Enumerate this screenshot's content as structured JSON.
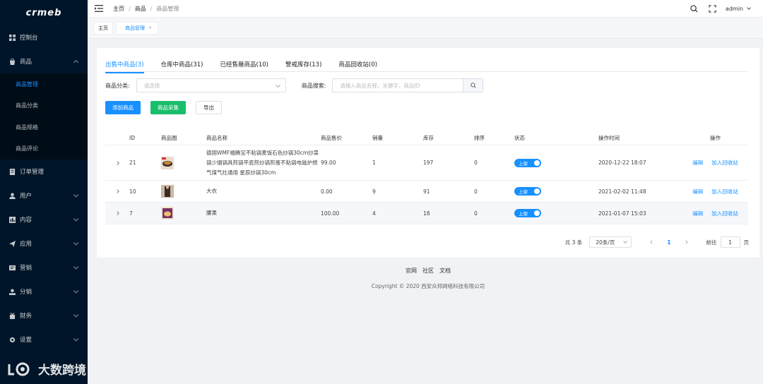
{
  "sidebar": {
    "logo": "crmeb",
    "items": [
      {
        "label": "控制台",
        "icon": "dashboard-icon"
      },
      {
        "label": "商品",
        "icon": "bag-icon",
        "expanded": true,
        "children": [
          {
            "label": "商品管理",
            "active": true
          },
          {
            "label": "商品分类"
          },
          {
            "label": "商品规格"
          },
          {
            "label": "商品评论"
          }
        ]
      },
      {
        "label": "订单管理",
        "icon": "order-icon"
      },
      {
        "label": "用户",
        "icon": "user-icon"
      },
      {
        "label": "内容",
        "icon": "content-icon"
      },
      {
        "label": "应用",
        "icon": "send-icon"
      },
      {
        "label": "营销",
        "icon": "marketing-icon"
      },
      {
        "label": "分销",
        "icon": "distribution-icon"
      },
      {
        "label": "财务",
        "icon": "finance-icon"
      },
      {
        "label": "设置",
        "icon": "settings-icon"
      }
    ]
  },
  "watermark": {
    "text": "大数跨境"
  },
  "header": {
    "breadcrumb": [
      "主页",
      "商品",
      "商品管理"
    ],
    "user": "admin"
  },
  "tags": [
    {
      "label": "主页"
    },
    {
      "label": "商品管理",
      "active": true,
      "close": "×"
    }
  ],
  "tabs": [
    {
      "label": "出售中商品(3)",
      "active": true
    },
    {
      "label": "仓库中商品(31)"
    },
    {
      "label": "已经售罄商品(10)"
    },
    {
      "label": "警戒库存(13)"
    },
    {
      "label": "商品回收站(0)"
    }
  ],
  "filters": {
    "category_label": "商品分类:",
    "category_placeholder": "请选择",
    "search_label": "商品搜索:",
    "search_placeholder": "请输入商品名称，关键字，商品ID"
  },
  "actions": {
    "add": "添加商品",
    "collect": "商品采集",
    "export": "导出"
  },
  "table": {
    "columns": [
      "ID",
      "商品图",
      "商品名称",
      "商品售价",
      "销量",
      "库存",
      "排序",
      "状态",
      "操作时间",
      "操作"
    ],
    "rows": [
      {
        "id": "21",
        "name": "德国WMF福腾宝不粘锅麦饭石色炒锅30cm炒菜锅少烟锅具煎锅平底煎炒锅煎蛋不粘锅电磁炉燃气煤气灶通用 星辰炒锅30cm",
        "price": "99.00",
        "sales": "1",
        "stock": "197",
        "sort": "0",
        "status": "上架",
        "time": "2020-12-22 18:07",
        "img_color": "#6b3a2a"
      },
      {
        "id": "10",
        "name": "大衣",
        "price": "0.00",
        "sales": "9",
        "stock": "91",
        "sort": "0",
        "status": "上架",
        "time": "2021-02-02 11:48",
        "img_color": "#7a5a45"
      },
      {
        "id": "7",
        "name": "腰果",
        "price": "100.00",
        "sales": "4",
        "stock": "18",
        "sort": "0",
        "status": "上架",
        "time": "2021-01-07 15:03",
        "img_color": "#8a3a6a"
      }
    ],
    "op_edit": "编辑",
    "op_recycle": "加入回收站"
  },
  "pagination": {
    "total": "共 3 条",
    "page_size": "20条/页",
    "current": "1",
    "goto_label": "前往",
    "goto_value": "1",
    "page_suffix": "页"
  },
  "footer": {
    "links": [
      "官网",
      "社区",
      "文档"
    ],
    "copyright": "Copyright © 2020 西安众邦网络科技有限公司"
  },
  "colors": {
    "primary": "#1890ff",
    "success": "#19be6b",
    "sidebar_bg": "#001529"
  }
}
